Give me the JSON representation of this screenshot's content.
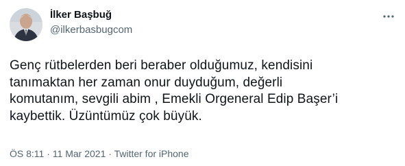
{
  "author": {
    "name": "İlker Başbuğ",
    "handle": "@ilkerbasbugcom"
  },
  "tweet": {
    "lines": [
      "Genç rütbelerden beri beraber olduğumuz, kendisini",
      "tanımaktan her zaman onur duyduğum, değerli",
      "komutanım, sevgili abim , Emekli Orgeneral Edip Başer’i",
      "kaybettik. Üzüntümüz çok büyük."
    ]
  },
  "meta": {
    "time": "ÖS 8:11",
    "separator": "·",
    "date": "11 Mar 2021",
    "source": "Twitter for iPhone"
  },
  "icons": {
    "more": "more-options-icon"
  },
  "colors": {
    "text": "#0f1419",
    "secondary": "#536471"
  }
}
